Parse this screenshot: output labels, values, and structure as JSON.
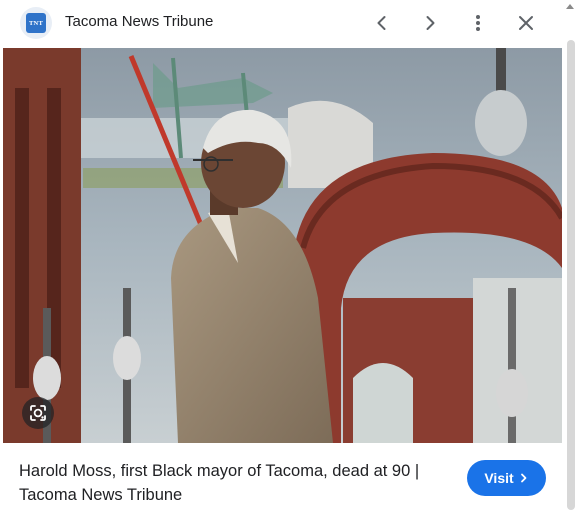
{
  "header": {
    "site_name": "Tacoma News Tribune",
    "logo_text": "TNT",
    "icons": [
      "chevron-left-icon",
      "chevron-right-icon",
      "more-vert-icon",
      "close-icon"
    ]
  },
  "image": {
    "lens_icon": "google-lens-icon"
  },
  "caption": {
    "title": "Harold Moss, first Black mayor of Tacoma, dead at 90 | Tacoma News Tribune"
  },
  "actions": {
    "visit_label": "Visit",
    "visit_icon": "chevron-right-icon"
  },
  "colors": {
    "accent": "#1a73e8",
    "text": "#202124",
    "icon": "#5f6368"
  }
}
